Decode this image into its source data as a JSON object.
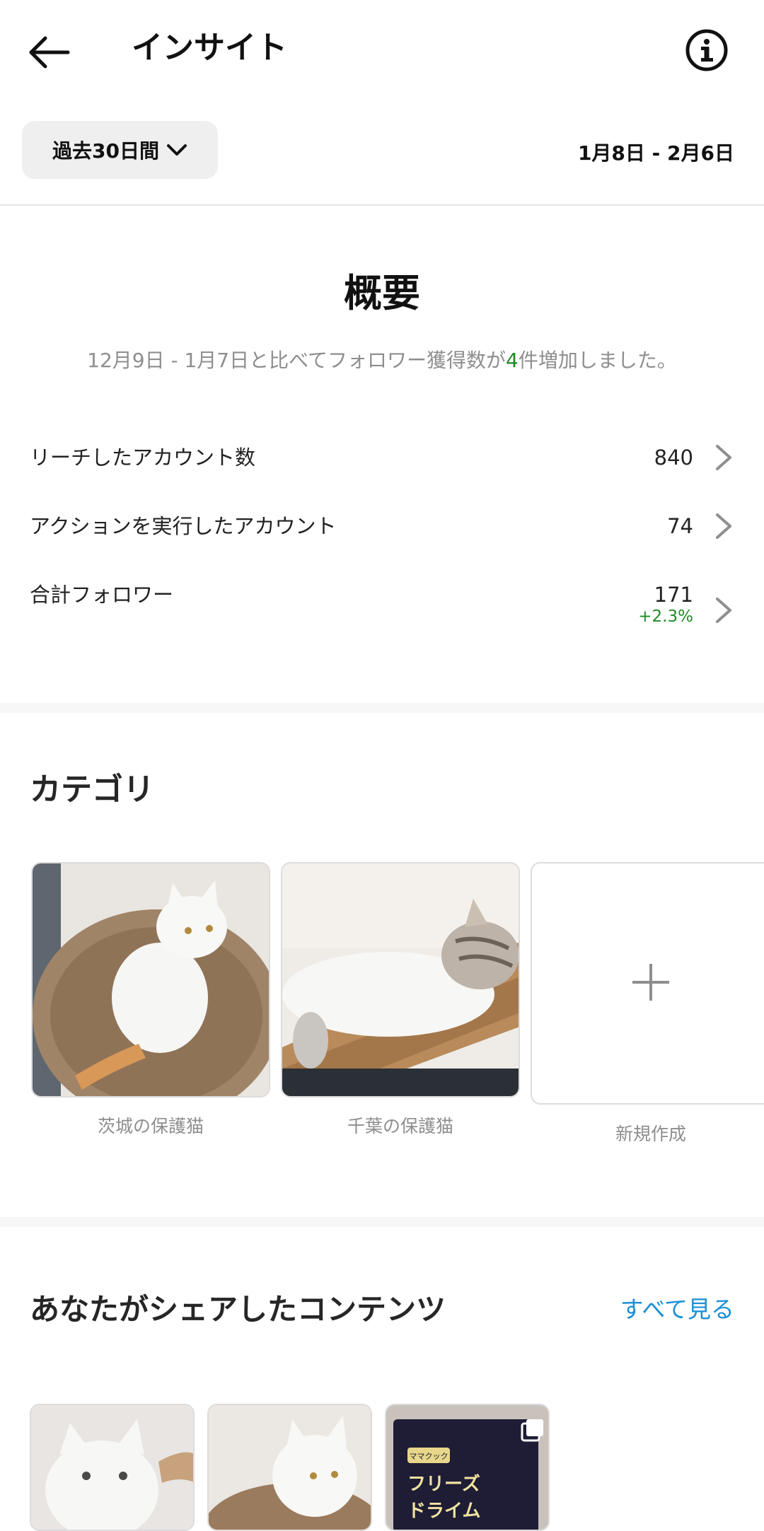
{
  "header": {
    "title": "インサイト",
    "back_icon": "arrow-left-icon",
    "info_icon": "info-circle-icon"
  },
  "filter": {
    "range_label": "過去30日間",
    "date_range": "1月8日 - 2月6日"
  },
  "overview": {
    "title": "概要",
    "summary_before": "12月9日 - 1月7日と比べてフォロワー獲得数が",
    "summary_number": "4",
    "summary_after": "件増加しました。",
    "metrics": [
      {
        "label": "リーチしたアカウント数",
        "value": "840"
      },
      {
        "label": "アクションを実行したアカウント",
        "value": "74"
      },
      {
        "label": "合計フォロワー",
        "value": "171",
        "change": "+2.3%"
      }
    ]
  },
  "categories": {
    "title": "カテゴリ",
    "items": [
      {
        "label": "茨城の保護猫"
      },
      {
        "label": "千葉の保護猫"
      },
      {
        "label": "新規作成"
      }
    ]
  },
  "shared": {
    "title": "あなたがシェアしたコンテンツ",
    "see_all": "すべて見る",
    "thumb3_text_1": "フリーズ",
    "thumb3_text_2": "ドライム",
    "thumb3_badge": "ママクック"
  },
  "colors": {
    "accent_link": "#1a8fd6",
    "positive": "#1f8b24",
    "muted": "#8e8e8e"
  }
}
